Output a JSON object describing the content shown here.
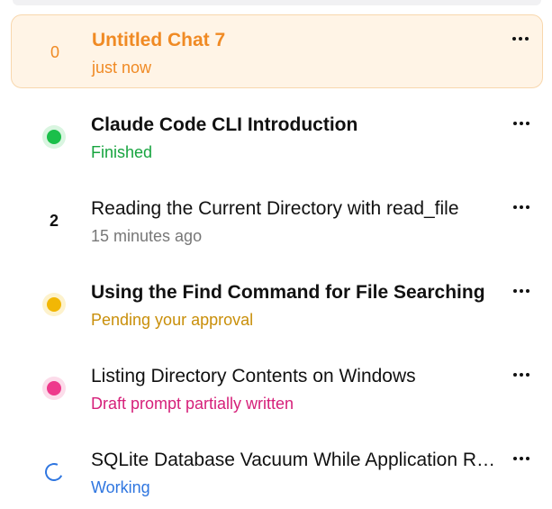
{
  "chats": [
    {
      "title": "Untitled Chat 7",
      "subtitle": "just now",
      "indicator": {
        "type": "count",
        "value": "0"
      },
      "active": true,
      "bold": true,
      "title_color": "#f08a24",
      "subtitle_color": "#f08a24"
    },
    {
      "title": "Claude Code CLI Introduction",
      "subtitle": "Finished",
      "indicator": {
        "type": "dot",
        "color": "#1bbf4a",
        "ring": "#d9f5e0"
      },
      "active": false,
      "bold": true,
      "title_color": "#111111",
      "subtitle_color": "#17a43f"
    },
    {
      "title": "Reading the Current Directory with read_file",
      "subtitle": "15 minutes ago",
      "indicator": {
        "type": "count",
        "value": "2"
      },
      "active": false,
      "bold": false,
      "title_color": "#111111",
      "subtitle_color": "#777777"
    },
    {
      "title": "Using the Find Command for File Searching",
      "subtitle": "Pending your approval",
      "indicator": {
        "type": "dot",
        "color": "#f2b705",
        "ring": "#fdf2cc"
      },
      "active": false,
      "bold": true,
      "title_color": "#111111",
      "subtitle_color": "#c98f0a"
    },
    {
      "title": "Listing Directory Contents on Windows",
      "subtitle": "Draft prompt partially written",
      "indicator": {
        "type": "dot",
        "color": "#ee3a8c",
        "ring": "#fcdcea"
      },
      "active": false,
      "bold": false,
      "title_color": "#111111",
      "subtitle_color": "#d6207a"
    },
    {
      "title": "SQLite Database Vacuum While Application Running",
      "subtitle": "Working",
      "indicator": {
        "type": "spinner",
        "color": "#2f76e0"
      },
      "active": false,
      "bold": false,
      "title_color": "#111111",
      "subtitle_color": "#2f76e0"
    }
  ]
}
